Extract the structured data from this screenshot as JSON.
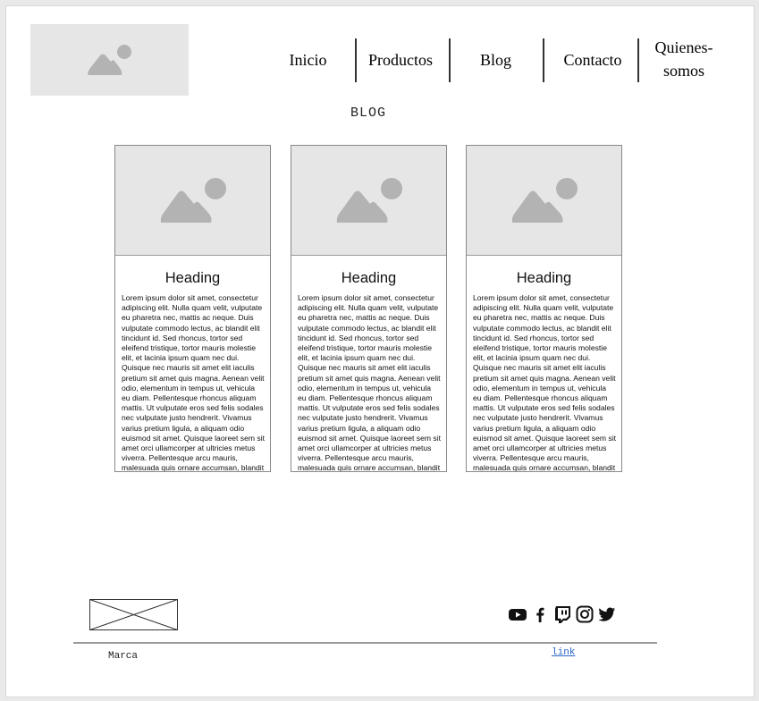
{
  "header": {
    "logo_icon": "image-placeholder-icon",
    "nav": [
      {
        "label": "Inicio"
      },
      {
        "label": "Productos"
      },
      {
        "label": "Blog"
      },
      {
        "label": "Contacto"
      },
      {
        "label": "Quienes-somos"
      }
    ]
  },
  "blog": {
    "title": "BLOG",
    "cards": [
      {
        "heading": "Heading",
        "body": "Lorem ipsum dolor sit amet, consectetur adipiscing elit. Nulla quam velit, vulputate eu pharetra nec, mattis ac neque. Duis vulputate commodo lectus, ac blandit elit tincidunt id. Sed rhoncus, tortor sed eleifend tristique, tortor mauris molestie elit, et lacinia ipsum quam nec dui. Quisque nec mauris sit amet elit iaculis pretium sit amet quis magna. Aenean velit odio, elementum in tempus ut, vehicula eu diam. Pellentesque rhoncus aliquam mattis. Ut vulputate eros sed felis sodales nec vulputate justo hendrerit. Vivamus varius pretium ligula, a aliquam odio euismod sit amet. Quisque laoreet sem sit amet orci ullamcorper at ultricies metus viverra. Pellentesque arcu mauris, malesuada quis ornare accumsan, blandit sed diam."
      },
      {
        "heading": "Heading",
        "body": "Lorem ipsum dolor sit amet, consectetur adipiscing elit. Nulla quam velit, vulputate eu pharetra nec, mattis ac neque. Duis vulputate commodo lectus, ac blandit elit tincidunt id. Sed rhoncus, tortor sed eleifend tristique, tortor mauris molestie elit, et lacinia ipsum quam nec dui. Quisque nec mauris sit amet elit iaculis pretium sit amet quis magna. Aenean velit odio, elementum in tempus ut, vehicula eu diam. Pellentesque rhoncus aliquam mattis. Ut vulputate eros sed felis sodales nec vulputate justo hendrerit. Vivamus varius pretium ligula, a aliquam odio euismod sit amet. Quisque laoreet sem sit amet orci ullamcorper at ultricies metus viverra. Pellentesque arcu mauris, malesuada quis ornare accumsan, blandit sed diam."
      },
      {
        "heading": "Heading",
        "body": "Lorem ipsum dolor sit amet, consectetur adipiscing elit. Nulla quam velit, vulputate eu pharetra nec, mattis ac neque. Duis vulputate commodo lectus, ac blandit elit tincidunt id. Sed rhoncus, tortor sed eleifend tristique, tortor mauris molestie elit, et lacinia ipsum quam nec dui. Quisque nec mauris sit amet elit iaculis pretium sit amet quis magna. Aenean velit odio, elementum in tempus ut, vehicula eu diam. Pellentesque rhoncus aliquam mattis. Ut vulputate eros sed felis sodales nec vulputate justo hendrerit. Vivamus varius pretium ligula, a aliquam odio euismod sit amet. Quisque laoreet sem sit amet orci ullamcorper at ultricies metus viverra. Pellentesque arcu mauris, malesuada quis ornare accumsan, blandit sed diam."
      }
    ]
  },
  "footer": {
    "placeholder_icon": "crossed-box-placeholder-icon",
    "social_icons": [
      "youtube-icon",
      "facebook-icon",
      "twitch-icon",
      "instagram-icon",
      "twitter-icon"
    ],
    "brand": "Marca",
    "link": "link"
  },
  "colors": {
    "placeholder_bg": "#e6e6e6",
    "placeholder_icon": "#b3b3b3",
    "link": "#2a67c9"
  }
}
